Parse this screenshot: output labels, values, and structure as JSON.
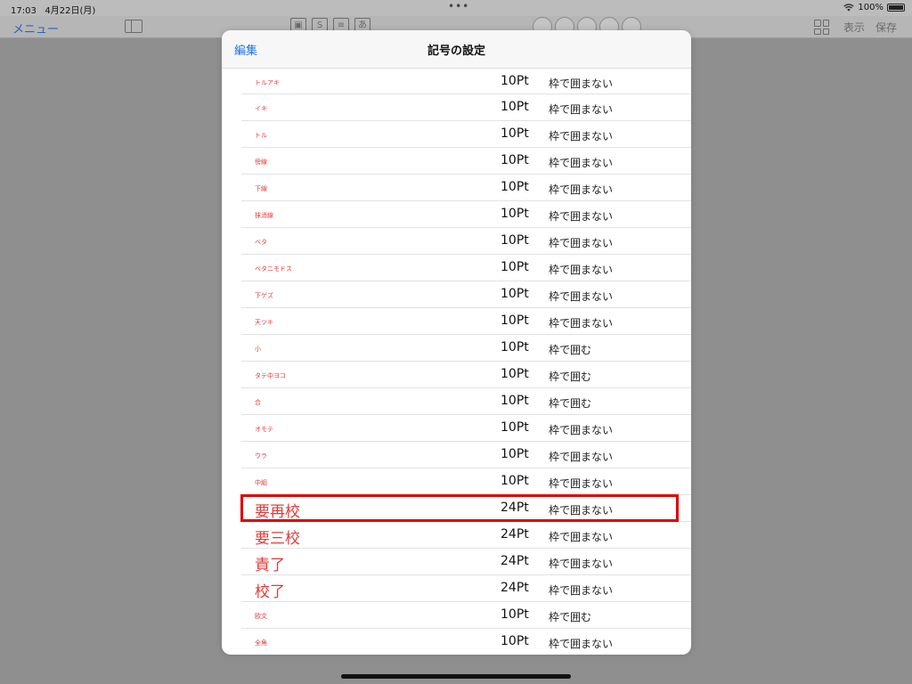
{
  "status_bar": {
    "time": "17:03",
    "date": "4月22日(月)",
    "dots": "•••",
    "battery_percent": "100%"
  },
  "toolbar": {
    "menu_label": "メニュー",
    "view_label": "表示",
    "save_label": "保存"
  },
  "modal": {
    "edit_label": "編集",
    "title": "記号の設定",
    "rows": [
      {
        "symbol": "トルアキ",
        "size": "10Pt",
        "frame": "枠で囲まない",
        "large": false
      },
      {
        "symbol": "イキ",
        "size": "10Pt",
        "frame": "枠で囲まない",
        "large": false
      },
      {
        "symbol": "トル",
        "size": "10Pt",
        "frame": "枠で囲まない",
        "large": false
      },
      {
        "symbol": "傍線",
        "size": "10Pt",
        "frame": "枠で囲まない",
        "large": false
      },
      {
        "symbol": "下線",
        "size": "10Pt",
        "frame": "枠で囲まない",
        "large": false
      },
      {
        "symbol": "抹消線",
        "size": "10Pt",
        "frame": "枠で囲まない",
        "large": false
      },
      {
        "symbol": "ベタ",
        "size": "10Pt",
        "frame": "枠で囲まない",
        "large": false
      },
      {
        "symbol": "ベタニモドス",
        "size": "10Pt",
        "frame": "枠で囲まない",
        "large": false
      },
      {
        "symbol": "下ゲズ",
        "size": "10Pt",
        "frame": "枠で囲まない",
        "large": false
      },
      {
        "symbol": "天ツキ",
        "size": "10Pt",
        "frame": "枠で囲まない",
        "large": false
      },
      {
        "symbol": "小",
        "size": "10Pt",
        "frame": "枠で囲む",
        "large": false
      },
      {
        "symbol": "タテ中ヨコ",
        "size": "10Pt",
        "frame": "枠で囲む",
        "large": false
      },
      {
        "symbol": "合",
        "size": "10Pt",
        "frame": "枠で囲む",
        "large": false
      },
      {
        "symbol": "オモテ",
        "size": "10Pt",
        "frame": "枠で囲まない",
        "large": false
      },
      {
        "symbol": "ウラ",
        "size": "10Pt",
        "frame": "枠で囲まない",
        "large": false
      },
      {
        "symbol": "中組",
        "size": "10Pt",
        "frame": "枠で囲まない",
        "large": false
      },
      {
        "symbol": "要再校",
        "size": "24Pt",
        "frame": "枠で囲まない",
        "large": true
      },
      {
        "symbol": "要三校",
        "size": "24Pt",
        "frame": "枠で囲まない",
        "large": true
      },
      {
        "symbol": "責了",
        "size": "24Pt",
        "frame": "枠で囲まない",
        "large": true
      },
      {
        "symbol": "校了",
        "size": "24Pt",
        "frame": "枠で囲まない",
        "large": true
      },
      {
        "symbol": "欧文",
        "size": "10Pt",
        "frame": "枠で囲む",
        "large": false
      },
      {
        "symbol": "全角",
        "size": "10Pt",
        "frame": "枠で囲まない",
        "large": false
      }
    ]
  },
  "colors": {
    "symbol_text": "#e23a3a",
    "accent_blue": "#1f72e8",
    "highlight_border": "#e00000"
  }
}
